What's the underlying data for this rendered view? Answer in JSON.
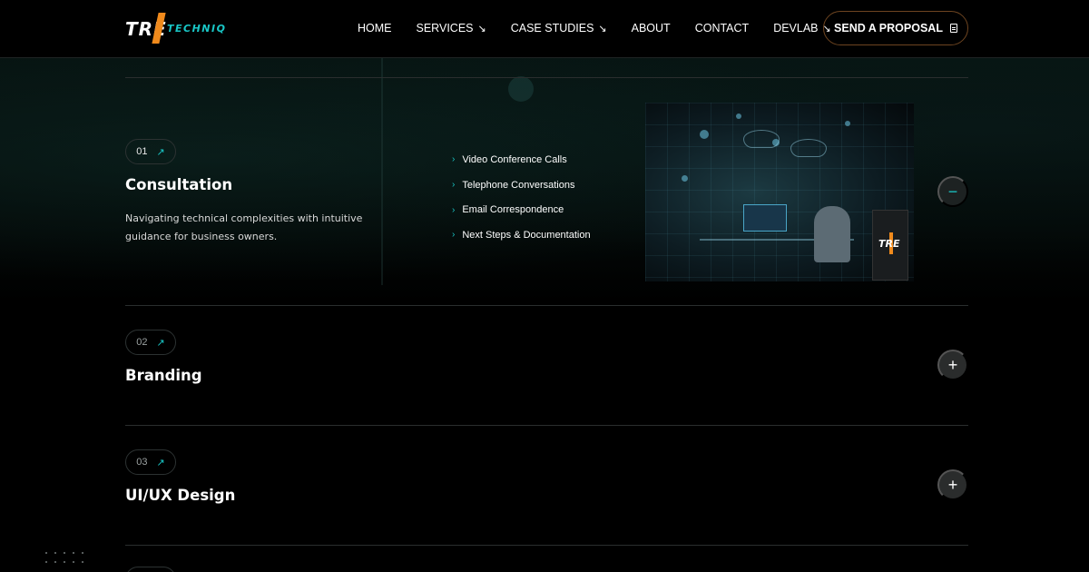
{
  "brand": {
    "logo_main": "TRE",
    "logo_sub": "TECHNIQ",
    "accent": "#19c7c7",
    "orange": "#f08a1c"
  },
  "nav": {
    "items": [
      {
        "label": "HOME",
        "dropdown": false
      },
      {
        "label": "SERVICES",
        "dropdown": true
      },
      {
        "label": "CASE STUDIES",
        "dropdown": true
      },
      {
        "label": "ABOUT",
        "dropdown": false
      },
      {
        "label": "CONTACT",
        "dropdown": false
      },
      {
        "label": "DEVLAB",
        "dropdown": true
      }
    ],
    "cta_label": "SEND A PROPOSAL",
    "cta_icon": "document-icon"
  },
  "services": [
    {
      "number": "01",
      "title": "Consultation",
      "description": "Navigating technical complexities with intuitive guidance for business owners.",
      "expanded": true,
      "bullets": [
        "Video Conference Calls",
        "Telephone Conversations",
        "Email Correspondence",
        "Next Steps & Documentation"
      ],
      "image_logo": "TRE",
      "toggle": "−"
    },
    {
      "number": "02",
      "title": "Branding",
      "expanded": false,
      "toggle": "+"
    },
    {
      "number": "03",
      "title": "UI/UX Design",
      "expanded": false,
      "toggle": "+"
    }
  ],
  "icons": {
    "arrow_se": "↘",
    "arrow_ne": "↗",
    "chevron": "›"
  }
}
